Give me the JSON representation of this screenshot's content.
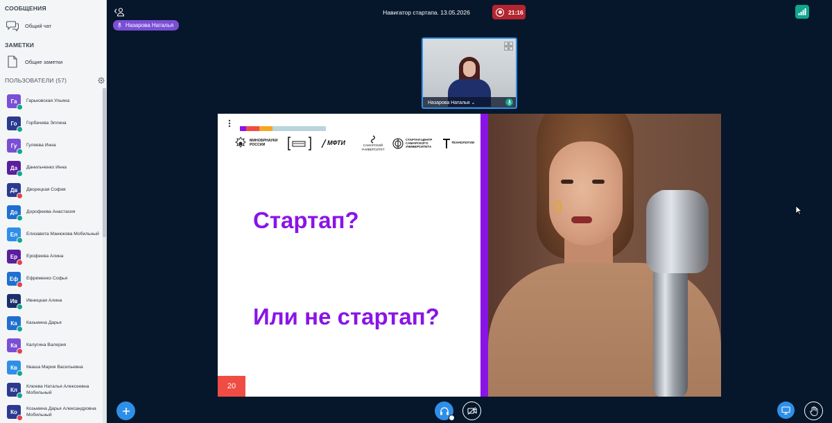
{
  "sidebar": {
    "messages_title": "СООБЩЕНИЯ",
    "chat_label": "Общий чат",
    "notes_title": "ЗАМЕТКИ",
    "notes_label": "Общие заметки",
    "users_title": "ПОЛЬЗОВАТЕЛИ (57)",
    "users": [
      {
        "initials": "Га",
        "name": "Гарьковская Ульяна",
        "color": "#7a4fd6",
        "status": "green"
      },
      {
        "initials": "Го",
        "name": "Горбачева Эллина",
        "color": "#2b3a8f",
        "status": "green"
      },
      {
        "initials": "Гу",
        "name": "Гуляева Инна",
        "color": "#7a4fd6",
        "status": "green"
      },
      {
        "initials": "Да",
        "name": "Данильченко Инна",
        "color": "#5a1f9e",
        "status": "green"
      },
      {
        "initials": "Дв",
        "name": "Дворецкая София",
        "color": "#2b3a8f",
        "status": "red"
      },
      {
        "initials": "До",
        "name": "Дорофеева Анастасия",
        "color": "#1f6fd1",
        "status": "green"
      },
      {
        "initials": "Ел",
        "name": "Елизавета Манюкова Мобильный",
        "color": "#2f8fe8",
        "status": "green"
      },
      {
        "initials": "Ер",
        "name": "Ерофеева Алина",
        "color": "#5a1f9e",
        "status": "red"
      },
      {
        "initials": "Еф",
        "name": "Ефременко Софья",
        "color": "#1f6fd1",
        "status": "red"
      },
      {
        "initials": "Ив",
        "name": "Ивницкая Алина",
        "color": "#1b2f6b",
        "status": "green"
      },
      {
        "initials": "Ка",
        "name": "Казьмина Дарья",
        "color": "#1f6fd1",
        "status": "green"
      },
      {
        "initials": "Ка",
        "name": "Калугина Валерия",
        "color": "#7a4fd6",
        "status": "red"
      },
      {
        "initials": "Кв",
        "name": "Кваша Мария Васильевна",
        "color": "#2f8fe8",
        "status": "green"
      },
      {
        "initials": "Кл",
        "name": "Клюева Наталья Алексеевна Мобильный",
        "color": "#2b3a8f",
        "status": "green"
      },
      {
        "initials": "Ко",
        "name": "Козьмина Дарья Александровна Мобильный",
        "color": "#2b3a8f",
        "status": "red"
      }
    ]
  },
  "topbar": {
    "presenter_pill": "Назарова Наталья",
    "meeting_title": "Навигатор стартапа. 13.05.2026",
    "recording_time": "21:16"
  },
  "camera": {
    "name": "Назарова Наталья ⌄"
  },
  "slide": {
    "question1": "Стартап?",
    "question2": "Или не стартап?",
    "page_number": "20",
    "logos": {
      "minobr": "МИНОБРНАУКИ РОССИИ",
      "mfti": "МФТИ",
      "samara": "САМАРСКИЙ УНИВЕРСИТЕТ",
      "startup_center": "СТАРТАП-ЦЕНТР САМАРСКОГО УНИВЕРСИТЕТА",
      "tech": "ТЕХНОЛОГИИ"
    },
    "colorbar": [
      "#8a14e6",
      "#ef4d43",
      "#f5a623",
      "#b9d4dc"
    ]
  },
  "colors": {
    "background": "#06172b",
    "accent": "#2f8fe8",
    "slide_purple": "#8a14e6",
    "recording": "#b3262f",
    "status_green": "#10a68d",
    "status_red": "#e0434a"
  },
  "icons": [
    "presenter-icon",
    "chat-icon",
    "notes-icon",
    "gear-icon",
    "mic-icon",
    "record-icon",
    "signal-icon",
    "expand-icon",
    "plus-icon",
    "headphones-icon",
    "camera-off-icon",
    "screen-share-icon",
    "raise-hand-icon"
  ]
}
